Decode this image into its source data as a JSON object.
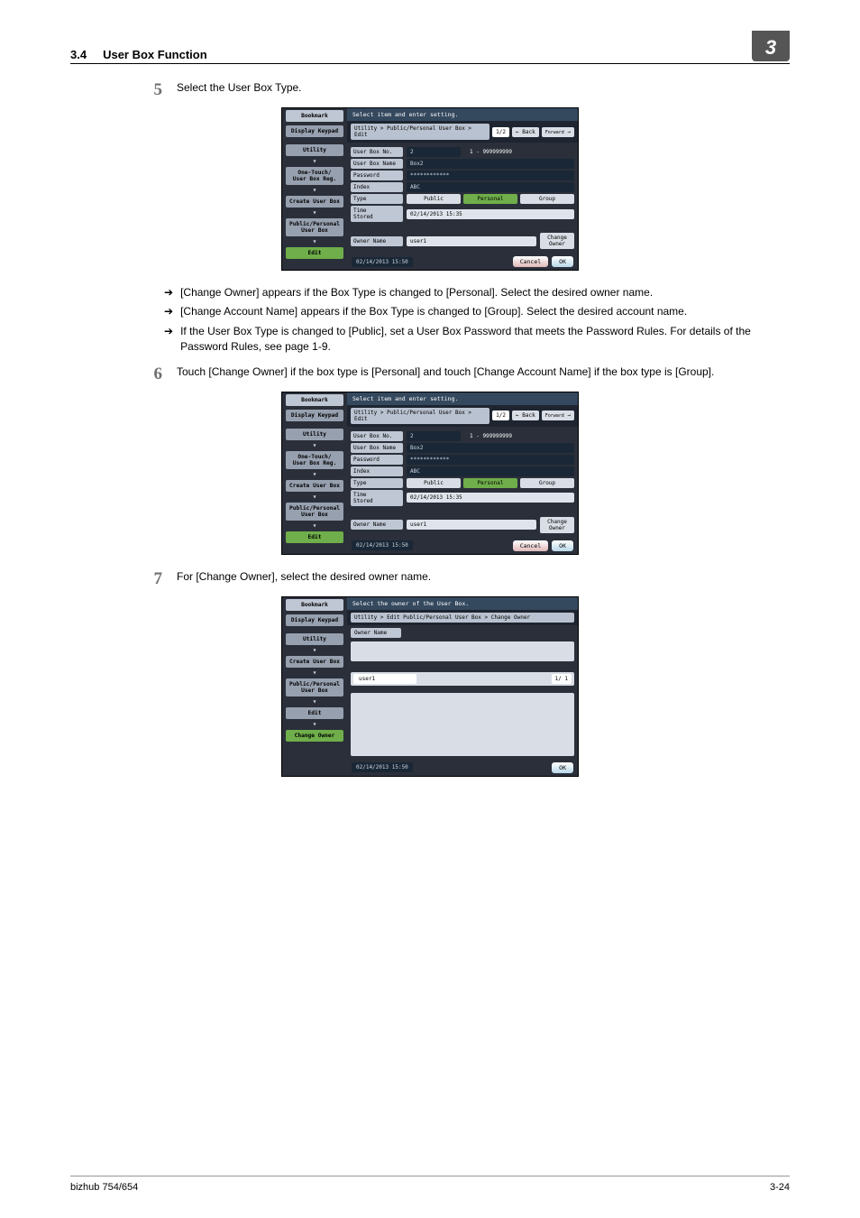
{
  "header": {
    "section": "3.4",
    "title": "User Box Function",
    "chapter_badge": "3"
  },
  "steps": {
    "s5": {
      "num": "5",
      "text": "Select the User Box Type."
    },
    "s6": {
      "num": "6",
      "text": "Touch [Change Owner] if the box type is [Personal] and touch [Change Account Name] if the box type is [Group]."
    },
    "s7": {
      "num": "7",
      "text": "For [Change Owner], select the desired owner name."
    }
  },
  "arrows": {
    "a1": "[Change Owner] appears if the Box Type is changed to [Personal]. Select the desired owner name.",
    "a2": "[Change Account Name] appears if the Box Type is changed to [Group]. Select the desired account name.",
    "a3": "If the User Box Type is changed to [Public], set a User Box Password that meets the Password Rules. For details of the Password Rules, see page 1-9."
  },
  "panel_edit": {
    "title": "Select item and enter setting.",
    "breadcrumb": "Utility > Public/Personal User  Box > Edit",
    "page": "1/2",
    "back": "Back",
    "forward": "Forward",
    "side": {
      "bookmark": "Bookmark",
      "display_keypad": "Display Keypad",
      "utility": "Utility",
      "onetouch": "One-Touch/\nUser Box Reg.",
      "create": "Create User Box",
      "pubper": "Public/Personal\nUser Box",
      "edit": "Edit"
    },
    "labels": {
      "box_no": "User Box No.",
      "box_name": "User Box Name",
      "password": "Password",
      "index": "Index",
      "type": "Type",
      "time_stored": "Time\nStored",
      "owner_name": "Owner Name"
    },
    "values": {
      "box_no": "2",
      "box_no_range": "1 - 999999999",
      "box_name": "Box2",
      "password": "************",
      "index": "ABC",
      "type_public": "Public",
      "type_personal": "Personal",
      "type_group": "Group",
      "time_stored": "02/14/2013  15:35",
      "owner_name": "user1",
      "change_owner": "Change\nOwner"
    },
    "timestamp": "02/14/2013   15:50",
    "cancel": "Cancel",
    "ok": "OK"
  },
  "panel_owner": {
    "title": "Select the owner of the User Box.",
    "breadcrumb": "Utility > Edit Public/Personal User Box > Change Owner",
    "side": {
      "bookmark": "Bookmark",
      "display_keypad": "Display Keypad",
      "utility": "Utility",
      "create": "Create User Box",
      "pubper": "Public/Personal\nUser Box",
      "edit": "Edit",
      "change_owner": "Change Owner"
    },
    "owner_label": "Owner Name",
    "owner_item": "user1",
    "page_ind": "1/  1",
    "timestamp": "02/14/2013   15:50",
    "ok": "OK"
  },
  "footer": {
    "model": "bizhub 754/654",
    "page": "3-24"
  }
}
